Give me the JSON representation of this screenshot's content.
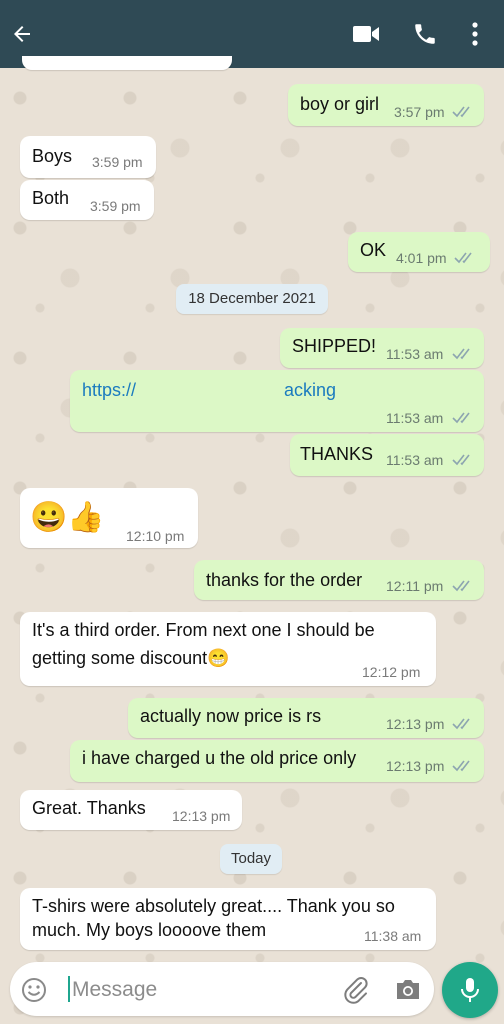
{
  "header": {
    "back_icon": "arrow-left-icon",
    "video_icon": "video-camera-icon",
    "call_icon": "phone-icon",
    "menu_icon": "more-vertical-icon",
    "background": "#2f4a55"
  },
  "messages": [
    {
      "dir": "out",
      "text": "boy or girl",
      "time": "3:57 pm",
      "read": true
    },
    {
      "dir": "in",
      "text": "Boys",
      "time": "3:59 pm"
    },
    {
      "dir": "in",
      "text": "Both",
      "time": "3:59 pm"
    },
    {
      "dir": "out",
      "text": "OK",
      "time": "4:01 pm",
      "read": true
    },
    {
      "dir": "date",
      "text": "18 December 2021"
    },
    {
      "dir": "out",
      "text": "SHIPPED!",
      "time": "11:53 am",
      "read": true
    },
    {
      "dir": "out",
      "text": "https://",
      "text2": "acking",
      "time": "11:53 am",
      "read": true
    },
    {
      "dir": "out",
      "text": "THANKS",
      "time": "11:53 am",
      "read": true
    },
    {
      "dir": "in",
      "text": "😀👍",
      "time": "12:10 pm"
    },
    {
      "dir": "out",
      "text": "thanks for the order",
      "time": "12:11 pm",
      "read": true
    },
    {
      "dir": "in",
      "line1": "It's a third order. From next one I should be",
      "line2": "getting some discount😁",
      "time": "12:12 pm"
    },
    {
      "dir": "out",
      "text": "actually now price is rs",
      "time": "12:13 pm",
      "read": true
    },
    {
      "dir": "out",
      "text": "i have charged u the old price only",
      "time": "12:13 pm",
      "read": true
    },
    {
      "dir": "in",
      "text": "Great. Thanks",
      "time": "12:13 pm"
    },
    {
      "dir": "date",
      "text": "Today"
    },
    {
      "dir": "in",
      "line1": "T-shirs were absolutely great.... Thank you so",
      "line2": "much. My boys loooove them",
      "time": "11:38 am"
    }
  ],
  "composer": {
    "placeholder": "Message",
    "emoji_icon": "emoji-icon",
    "attach_icon": "paperclip-icon",
    "camera_icon": "camera-icon",
    "mic_icon": "microphone-icon"
  },
  "colors": {
    "outgoing_bubble": "#dcf8c6",
    "incoming_bubble": "#ffffff",
    "read_ticks": "#4fa3d9",
    "mic_button": "#20a889"
  }
}
